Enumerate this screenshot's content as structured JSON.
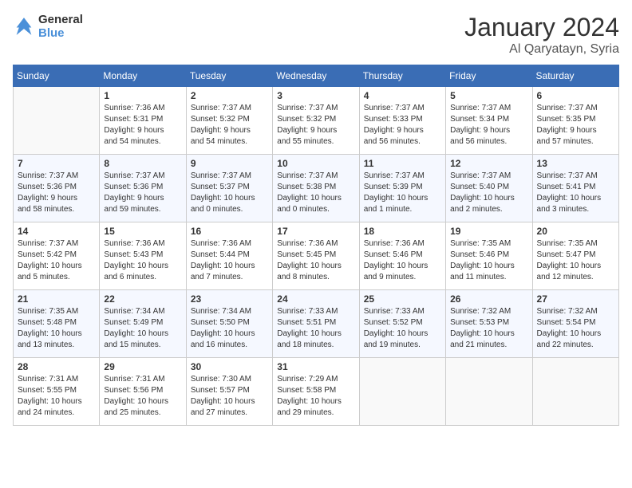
{
  "header": {
    "logo_general": "General",
    "logo_blue": "Blue",
    "month_year": "January 2024",
    "location": "Al Qaryatayn, Syria"
  },
  "days_of_week": [
    "Sunday",
    "Monday",
    "Tuesday",
    "Wednesday",
    "Thursday",
    "Friday",
    "Saturday"
  ],
  "weeks": [
    [
      {
        "day": "",
        "info": ""
      },
      {
        "day": "1",
        "info": "Sunrise: 7:36 AM\nSunset: 5:31 PM\nDaylight: 9 hours\nand 54 minutes."
      },
      {
        "day": "2",
        "info": "Sunrise: 7:37 AM\nSunset: 5:32 PM\nDaylight: 9 hours\nand 54 minutes."
      },
      {
        "day": "3",
        "info": "Sunrise: 7:37 AM\nSunset: 5:32 PM\nDaylight: 9 hours\nand 55 minutes."
      },
      {
        "day": "4",
        "info": "Sunrise: 7:37 AM\nSunset: 5:33 PM\nDaylight: 9 hours\nand 56 minutes."
      },
      {
        "day": "5",
        "info": "Sunrise: 7:37 AM\nSunset: 5:34 PM\nDaylight: 9 hours\nand 56 minutes."
      },
      {
        "day": "6",
        "info": "Sunrise: 7:37 AM\nSunset: 5:35 PM\nDaylight: 9 hours\nand 57 minutes."
      }
    ],
    [
      {
        "day": "7",
        "info": "Sunrise: 7:37 AM\nSunset: 5:36 PM\nDaylight: 9 hours\nand 58 minutes."
      },
      {
        "day": "8",
        "info": "Sunrise: 7:37 AM\nSunset: 5:36 PM\nDaylight: 9 hours\nand 59 minutes."
      },
      {
        "day": "9",
        "info": "Sunrise: 7:37 AM\nSunset: 5:37 PM\nDaylight: 10 hours\nand 0 minutes."
      },
      {
        "day": "10",
        "info": "Sunrise: 7:37 AM\nSunset: 5:38 PM\nDaylight: 10 hours\nand 0 minutes."
      },
      {
        "day": "11",
        "info": "Sunrise: 7:37 AM\nSunset: 5:39 PM\nDaylight: 10 hours\nand 1 minute."
      },
      {
        "day": "12",
        "info": "Sunrise: 7:37 AM\nSunset: 5:40 PM\nDaylight: 10 hours\nand 2 minutes."
      },
      {
        "day": "13",
        "info": "Sunrise: 7:37 AM\nSunset: 5:41 PM\nDaylight: 10 hours\nand 3 minutes."
      }
    ],
    [
      {
        "day": "14",
        "info": "Sunrise: 7:37 AM\nSunset: 5:42 PM\nDaylight: 10 hours\nand 5 minutes."
      },
      {
        "day": "15",
        "info": "Sunrise: 7:36 AM\nSunset: 5:43 PM\nDaylight: 10 hours\nand 6 minutes."
      },
      {
        "day": "16",
        "info": "Sunrise: 7:36 AM\nSunset: 5:44 PM\nDaylight: 10 hours\nand 7 minutes."
      },
      {
        "day": "17",
        "info": "Sunrise: 7:36 AM\nSunset: 5:45 PM\nDaylight: 10 hours\nand 8 minutes."
      },
      {
        "day": "18",
        "info": "Sunrise: 7:36 AM\nSunset: 5:46 PM\nDaylight: 10 hours\nand 9 minutes."
      },
      {
        "day": "19",
        "info": "Sunrise: 7:35 AM\nSunset: 5:46 PM\nDaylight: 10 hours\nand 11 minutes."
      },
      {
        "day": "20",
        "info": "Sunrise: 7:35 AM\nSunset: 5:47 PM\nDaylight: 10 hours\nand 12 minutes."
      }
    ],
    [
      {
        "day": "21",
        "info": "Sunrise: 7:35 AM\nSunset: 5:48 PM\nDaylight: 10 hours\nand 13 minutes."
      },
      {
        "day": "22",
        "info": "Sunrise: 7:34 AM\nSunset: 5:49 PM\nDaylight: 10 hours\nand 15 minutes."
      },
      {
        "day": "23",
        "info": "Sunrise: 7:34 AM\nSunset: 5:50 PM\nDaylight: 10 hours\nand 16 minutes."
      },
      {
        "day": "24",
        "info": "Sunrise: 7:33 AM\nSunset: 5:51 PM\nDaylight: 10 hours\nand 18 minutes."
      },
      {
        "day": "25",
        "info": "Sunrise: 7:33 AM\nSunset: 5:52 PM\nDaylight: 10 hours\nand 19 minutes."
      },
      {
        "day": "26",
        "info": "Sunrise: 7:32 AM\nSunset: 5:53 PM\nDaylight: 10 hours\nand 21 minutes."
      },
      {
        "day": "27",
        "info": "Sunrise: 7:32 AM\nSunset: 5:54 PM\nDaylight: 10 hours\nand 22 minutes."
      }
    ],
    [
      {
        "day": "28",
        "info": "Sunrise: 7:31 AM\nSunset: 5:55 PM\nDaylight: 10 hours\nand 24 minutes."
      },
      {
        "day": "29",
        "info": "Sunrise: 7:31 AM\nSunset: 5:56 PM\nDaylight: 10 hours\nand 25 minutes."
      },
      {
        "day": "30",
        "info": "Sunrise: 7:30 AM\nSunset: 5:57 PM\nDaylight: 10 hours\nand 27 minutes."
      },
      {
        "day": "31",
        "info": "Sunrise: 7:29 AM\nSunset: 5:58 PM\nDaylight: 10 hours\nand 29 minutes."
      },
      {
        "day": "",
        "info": ""
      },
      {
        "day": "",
        "info": ""
      },
      {
        "day": "",
        "info": ""
      }
    ]
  ]
}
